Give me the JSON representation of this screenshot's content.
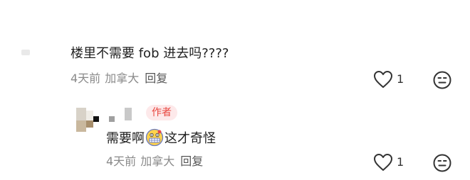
{
  "comments": [
    {
      "text": "楼里不需要 fob 进去吗????",
      "time": "4天前",
      "location": "加拿大",
      "reply_label": "回复",
      "likes": "1"
    },
    {
      "author_badge": "作者",
      "text_before": "需要啊",
      "emoji": "grimacing-face-emoji",
      "text_after": "这才奇怪",
      "time": "4天前",
      "location": "加拿大",
      "reply_label": "回复",
      "likes": "1"
    }
  ],
  "icons": {
    "like": "heart-outline-icon",
    "dislike": "annoyed-face-icon"
  },
  "colors": {
    "badge_bg": "#fde9ea",
    "badge_text": "#e8463f",
    "meta_text": "#8a8a8a"
  }
}
